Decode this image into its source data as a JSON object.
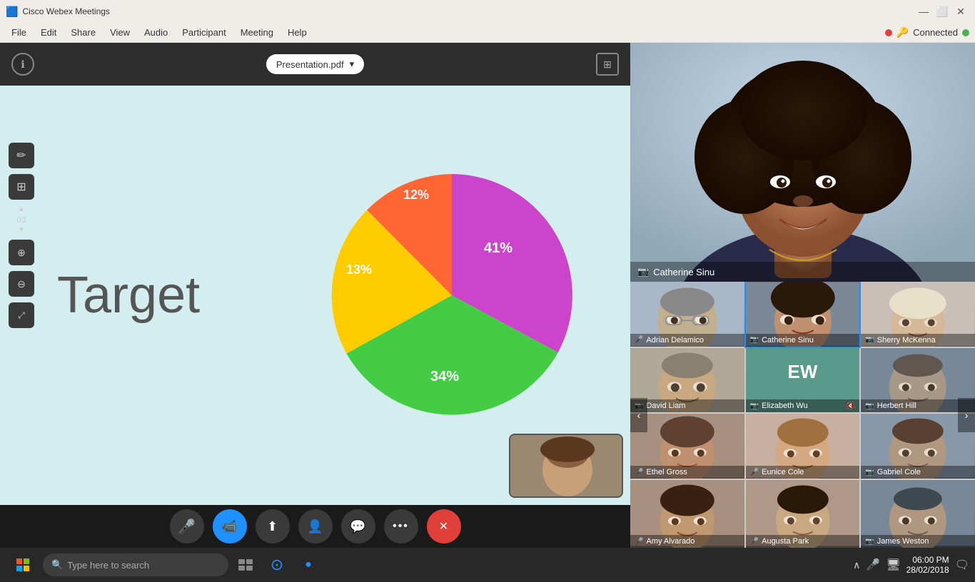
{
  "app": {
    "title": "Cisco Webex Meetings",
    "logo": "🟦"
  },
  "titlebar": {
    "minimize": "—",
    "maximize": "⬜",
    "close": "✕"
  },
  "menu": {
    "items": [
      "File",
      "Edit",
      "Share",
      "View",
      "Audio",
      "Participant",
      "Meeting",
      "Help"
    ]
  },
  "status": {
    "connected_label": "Connected"
  },
  "presentation": {
    "file_label": "Presentation.pdf",
    "info_icon": "ℹ",
    "expand_icon": "⊞",
    "chevron": "▾"
  },
  "slide": {
    "title": "Target",
    "chart": {
      "segments": [
        {
          "label": "41%",
          "color": "#cc44cc",
          "value": 41
        },
        {
          "label": "34%",
          "color": "#44cc44",
          "value": 34
        },
        {
          "label": "13%",
          "color": "#ffcc00",
          "value": 13
        },
        {
          "label": "12%",
          "color": "#ff6633",
          "value": 12
        }
      ]
    }
  },
  "tools": {
    "draw": "✏",
    "grid": "⊞",
    "arrow_up": "▲",
    "page_num": "03",
    "arrow_dn": "▼",
    "zoom_in": "🔍",
    "zoom_out": "🔍",
    "expand": "⤢"
  },
  "controls": {
    "mic": "🎤",
    "video": "📹",
    "share": "⬆",
    "participants": "👤",
    "chat": "💬",
    "more": "•••",
    "end": "✕"
  },
  "featured": {
    "name": "Catherine Sinu",
    "camera_icon": "📷"
  },
  "participants": [
    {
      "name": "Adrian Delamico",
      "icon": "🎤",
      "muted": true,
      "face_class": "face-adrian"
    },
    {
      "name": "Catherine Sinu",
      "icon": "📷",
      "muted": false,
      "face_class": "face-catherine-s",
      "active": true
    },
    {
      "name": "Sherry McKenna",
      "icon": "📷",
      "muted": false,
      "face_class": "face-sherry"
    },
    {
      "name": "David Liam",
      "icon": "📷",
      "muted": false,
      "face_class": "face-david"
    },
    {
      "name": "Elizabeth Wu",
      "icon": "📷",
      "muted": true,
      "face_class": "avatar-ew",
      "is_avatar": true,
      "initials": "EW"
    },
    {
      "name": "Herbert Hill",
      "icon": "📷",
      "muted": false,
      "face_class": "face-herbert"
    },
    {
      "name": "Ethel Gross",
      "icon": "🎤",
      "muted": false,
      "face_class": "face-ethel"
    },
    {
      "name": "Eunice Cole",
      "icon": "🎤",
      "muted": false,
      "face_class": "face-eunice"
    },
    {
      "name": "Gabriel Cole",
      "icon": "📷",
      "muted": false,
      "face_class": "face-gabriel"
    },
    {
      "name": "Amy Alvarado",
      "icon": "🎤",
      "muted": false,
      "face_class": "face-amy"
    },
    {
      "name": "Augusta Park",
      "icon": "🎤",
      "muted": false,
      "face_class": "face-augusta"
    },
    {
      "name": "James Weston",
      "icon": "📷",
      "muted": false,
      "face_class": "face-james"
    }
  ],
  "taskbar": {
    "search_placeholder": "Type here to search",
    "time": "06:00 PM",
    "date": "28/02/2018"
  }
}
